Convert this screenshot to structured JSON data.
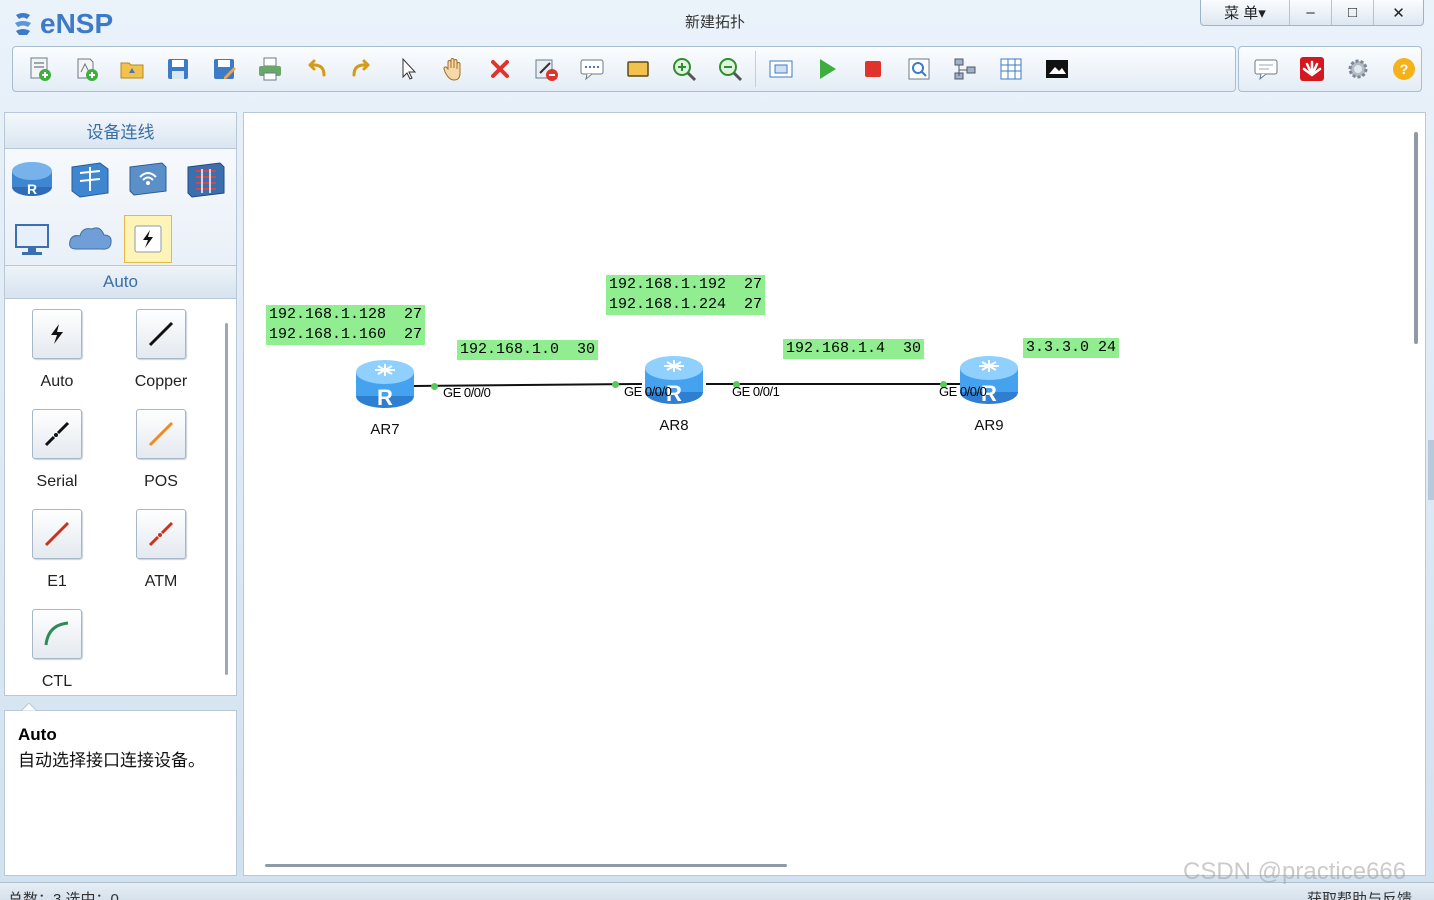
{
  "app": {
    "name": "eNSP",
    "window_title": "新建拓扑",
    "menu_label": "菜 单▾",
    "minimize_glyph": "–",
    "maximize_glyph": "□",
    "close_glyph": "✕"
  },
  "toolbar": {
    "buttons": [
      "new-topology",
      "new-example",
      "open",
      "save",
      "save-as",
      "print",
      "undo",
      "redo",
      "select",
      "pan",
      "delete",
      "delete-link",
      "text-note",
      "rectangle",
      "zoom-in",
      "zoom-out",
      "fit",
      "start",
      "stop",
      "capture",
      "topology-tree",
      "table",
      "screenshot"
    ],
    "right_buttons": [
      "forum",
      "huawei",
      "settings",
      "help"
    ]
  },
  "left_panel": {
    "header": "设备连线",
    "categories": [
      "router",
      "switch",
      "wireless",
      "firewall",
      "pc",
      "cloud",
      "connection"
    ],
    "selected_category": "connection",
    "sub_header": "Auto",
    "cables": [
      {
        "label": "Auto",
        "color": "#000000"
      },
      {
        "label": "Copper",
        "color": "#000000"
      },
      {
        "label": "Serial",
        "color": "#000000"
      },
      {
        "label": "POS",
        "color": "#f08a1c"
      },
      {
        "label": "E1",
        "color": "#c8321e"
      },
      {
        "label": "ATM",
        "color": "#c8321e"
      },
      {
        "label": "CTL",
        "color": "#2e8b57"
      }
    ]
  },
  "info": {
    "title": "Auto",
    "description": "自动选择接口连接设备。"
  },
  "topology": {
    "labels": [
      {
        "text": "192.168.1.128  27\n192.168.1.160  27"
      },
      {
        "text": "192.168.1.0  30"
      },
      {
        "text": "192.168.1.192  27\n192.168.1.224  27"
      },
      {
        "text": "192.168.1.4  30"
      },
      {
        "text": "3.3.3.0 24"
      }
    ],
    "devices": [
      {
        "name": "AR7"
      },
      {
        "name": "AR8"
      },
      {
        "name": "AR9"
      }
    ],
    "ports": [
      "GE 0/0/0",
      "GE 0/0/0",
      "GE 0/0/1",
      "GE 0/0/0"
    ]
  },
  "status": {
    "left": "总数：3  选中：0",
    "right": "获取帮助与反馈"
  },
  "watermark": "CSDN @practice666"
}
